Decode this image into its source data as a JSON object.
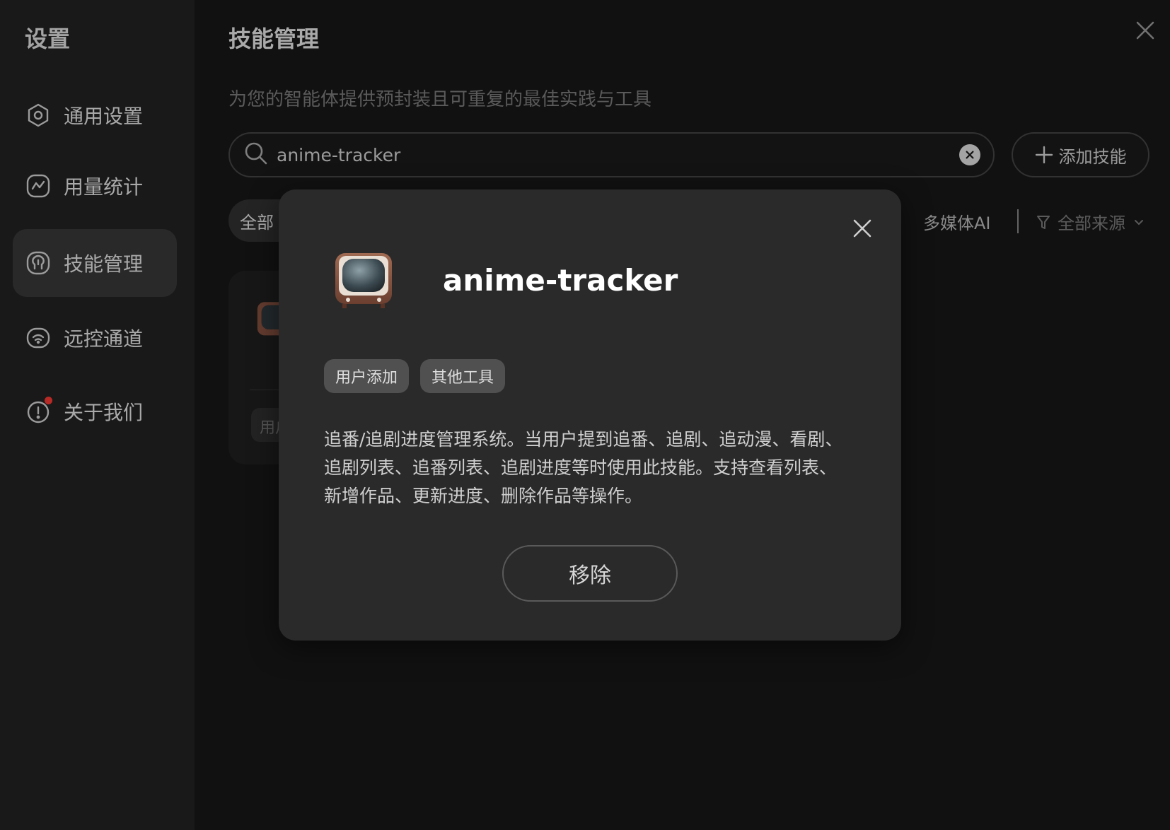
{
  "sidebar": {
    "title": "设置",
    "items": [
      {
        "label": "通用设置",
        "icon": "gear-icon"
      },
      {
        "label": "用量统计",
        "icon": "chart-icon"
      },
      {
        "label": "技能管理",
        "icon": "skill-icon",
        "active": true
      },
      {
        "label": "远控通道",
        "icon": "wifi-icon"
      },
      {
        "label": "关于我们",
        "icon": "info-icon",
        "badge": "red-dot"
      }
    ]
  },
  "main": {
    "title": "技能管理",
    "subtitle": "为您的智能体提供预封装且可重复的最佳实践与工具",
    "search": {
      "value": "anime-tracker"
    },
    "add_button": "添加技能",
    "filters": {
      "all": "全部",
      "multimedia": "多媒体AI",
      "source": "全部来源"
    },
    "bg_card_tag": "用户"
  },
  "modal": {
    "title": "anime-tracker",
    "icon": "tv-icon",
    "tags": [
      "用户添加",
      "其他工具"
    ],
    "description": "追番/追剧进度管理系统。当用户提到追番、追剧、追动漫、看剧、追剧列表、追番列表、追剧进度等时使用此技能。支持查看列表、新增作品、更新进度、删除作品等操作。",
    "remove_button": "移除"
  },
  "colors": {
    "background": "#151515",
    "sidebar": "#1f1f1f",
    "modal": "#2a2a2a",
    "badge_red": "#e0342f"
  }
}
